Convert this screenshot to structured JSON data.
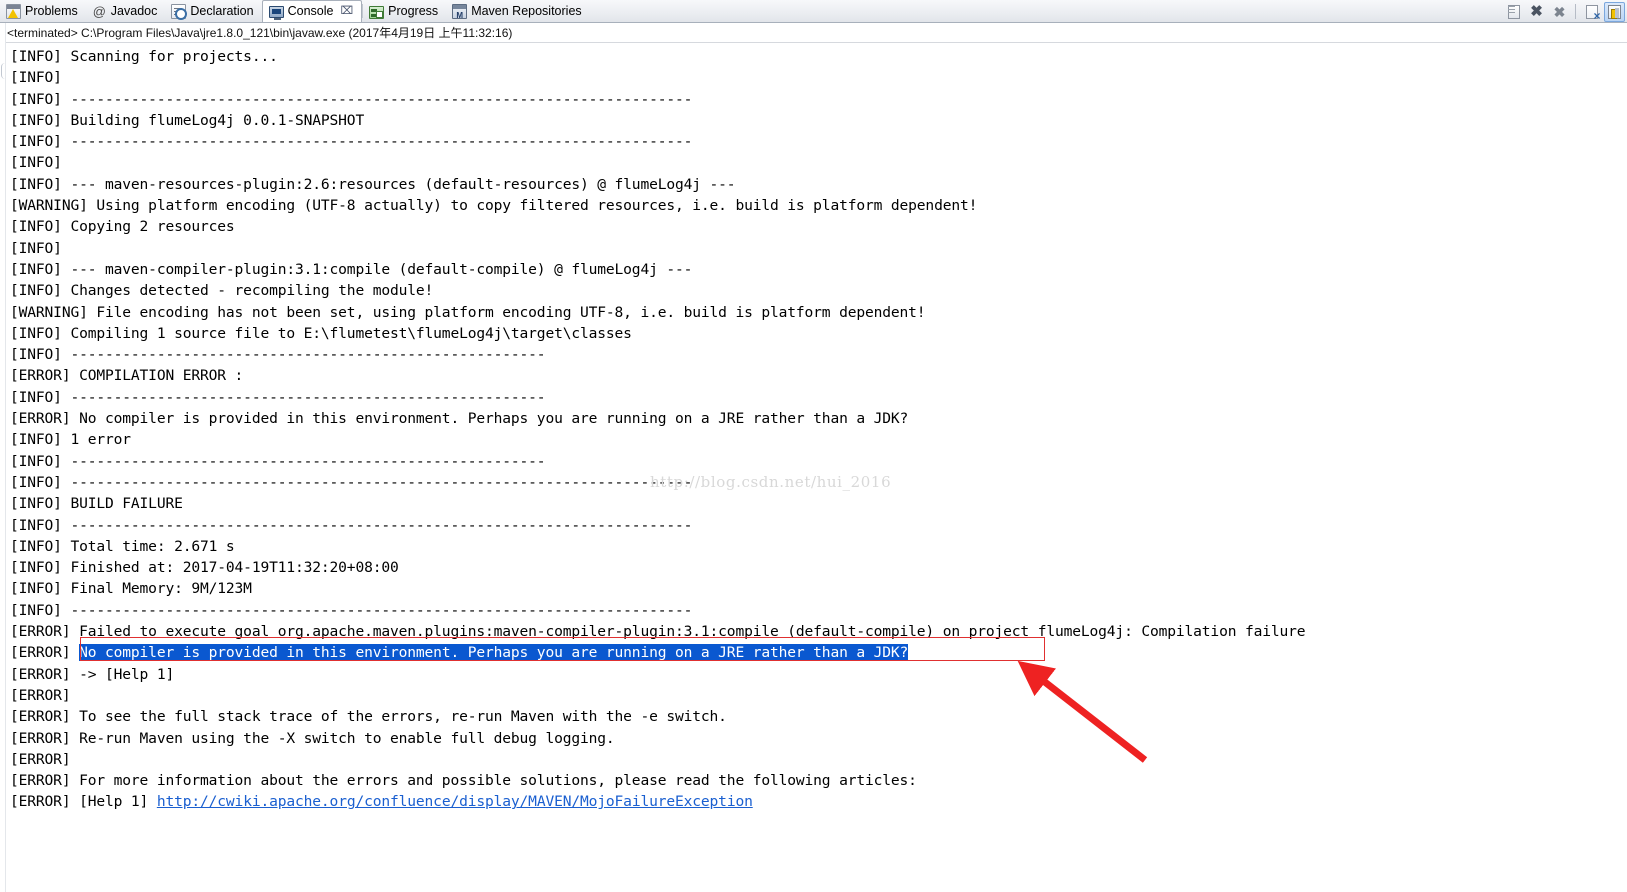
{
  "window": {
    "tabs": [
      {
        "label": "Problems",
        "icon": "problems-icon",
        "active": false
      },
      {
        "label": "Javadoc",
        "icon": "javadoc-icon",
        "active": false
      },
      {
        "label": "Declaration",
        "icon": "declaration-icon",
        "active": false
      },
      {
        "label": "Console",
        "icon": "console-icon",
        "active": true,
        "close": "⌧"
      },
      {
        "label": "Progress",
        "icon": "progress-icon",
        "active": false
      },
      {
        "label": "Maven Repositories",
        "icon": "maven-repositories-icon",
        "active": false
      }
    ],
    "toolbar": [
      {
        "name": "scroll-lock-icon",
        "glyph": "page"
      },
      {
        "name": "terminate-icon",
        "glyph": "x"
      },
      {
        "name": "remove-all-terminated-icon",
        "glyph": "xx"
      },
      {
        "name": "separator",
        "glyph": "sep"
      },
      {
        "name": "clear-console-icon",
        "glyph": "docx"
      },
      {
        "name": "pin-console-icon",
        "glyph": "lock",
        "selected": true
      }
    ]
  },
  "terminated_bar": {
    "text": "<terminated> C:\\Program Files\\Java\\jre1.8.0_121\\bin\\javaw.exe (2017年4月19日 上午11:32:16)"
  },
  "watermark": {
    "text": "http://blog.csdn.net/hui_2016"
  },
  "console": {
    "separator_long": "------------------------------------------------------------------------",
    "separator_short": "-------------------------------------------------------",
    "lines": [
      "[INFO] Scanning for projects...",
      "[INFO] ",
      "[INFO] ------------------------------------------------------------------------",
      "[INFO] Building flumeLog4j 0.0.1-SNAPSHOT",
      "[INFO] ------------------------------------------------------------------------",
      "[INFO] ",
      "[INFO] --- maven-resources-plugin:2.6:resources (default-resources) @ flumeLog4j ---",
      "[WARNING] Using platform encoding (UTF-8 actually) to copy filtered resources, i.e. build is platform dependent!",
      "[INFO] Copying 2 resources",
      "[INFO] ",
      "[INFO] --- maven-compiler-plugin:3.1:compile (default-compile) @ flumeLog4j ---",
      "[INFO] Changes detected - recompiling the module!",
      "[WARNING] File encoding has not been set, using platform encoding UTF-8, i.e. build is platform dependent!",
      "[INFO] Compiling 1 source file to E:\\flumetest\\flumeLog4j\\target\\classes",
      "[INFO] -------------------------------------------------------",
      "[ERROR] COMPILATION ERROR : ",
      "[INFO] -------------------------------------------------------",
      "[ERROR] No compiler is provided in this environment. Perhaps you are running on a JRE rather than a JDK?",
      "[INFO] 1 error",
      "[INFO] -------------------------------------------------------",
      "[INFO] ------------------------------------------------------------------------",
      "[INFO] BUILD FAILURE",
      "[INFO] ------------------------------------------------------------------------",
      "[INFO] Total time: 2.671 s",
      "[INFO] Finished at: 2017-04-19T11:32:20+08:00",
      "[INFO] Final Memory: 9M/123M",
      "[INFO] ------------------------------------------------------------------------",
      "[ERROR] Failed to execute goal org.apache.maven.plugins:maven-compiler-plugin:3.1:compile (default-compile) on project flumeLog4j: Compilation failure"
    ],
    "highlighted_line": {
      "prefix": "[ERROR] ",
      "selected_text": "No compiler is provided in this environment. Perhaps you are running on a JRE rather than a JDK?",
      "selection_color": "#0a58d0",
      "box_color": "#e03030"
    },
    "lines_after": [
      "[ERROR] -> [Help 1]",
      "[ERROR] ",
      "[ERROR] To see the full stack trace of the errors, re-run Maven with the -e switch.",
      "[ERROR] Re-run Maven using the -X switch to enable full debug logging.",
      "[ERROR] ",
      "[ERROR] For more information about the errors and possible solutions, please read the following articles:"
    ],
    "link_line": {
      "prefix": "[ERROR] [Help 1] ",
      "url": "http://cwiki.apache.org/confluence/display/MAVEN/MojoFailureException",
      "link_color": "#1a5fd0"
    }
  },
  "annotation": {
    "arrow_color": "#ee2222"
  }
}
